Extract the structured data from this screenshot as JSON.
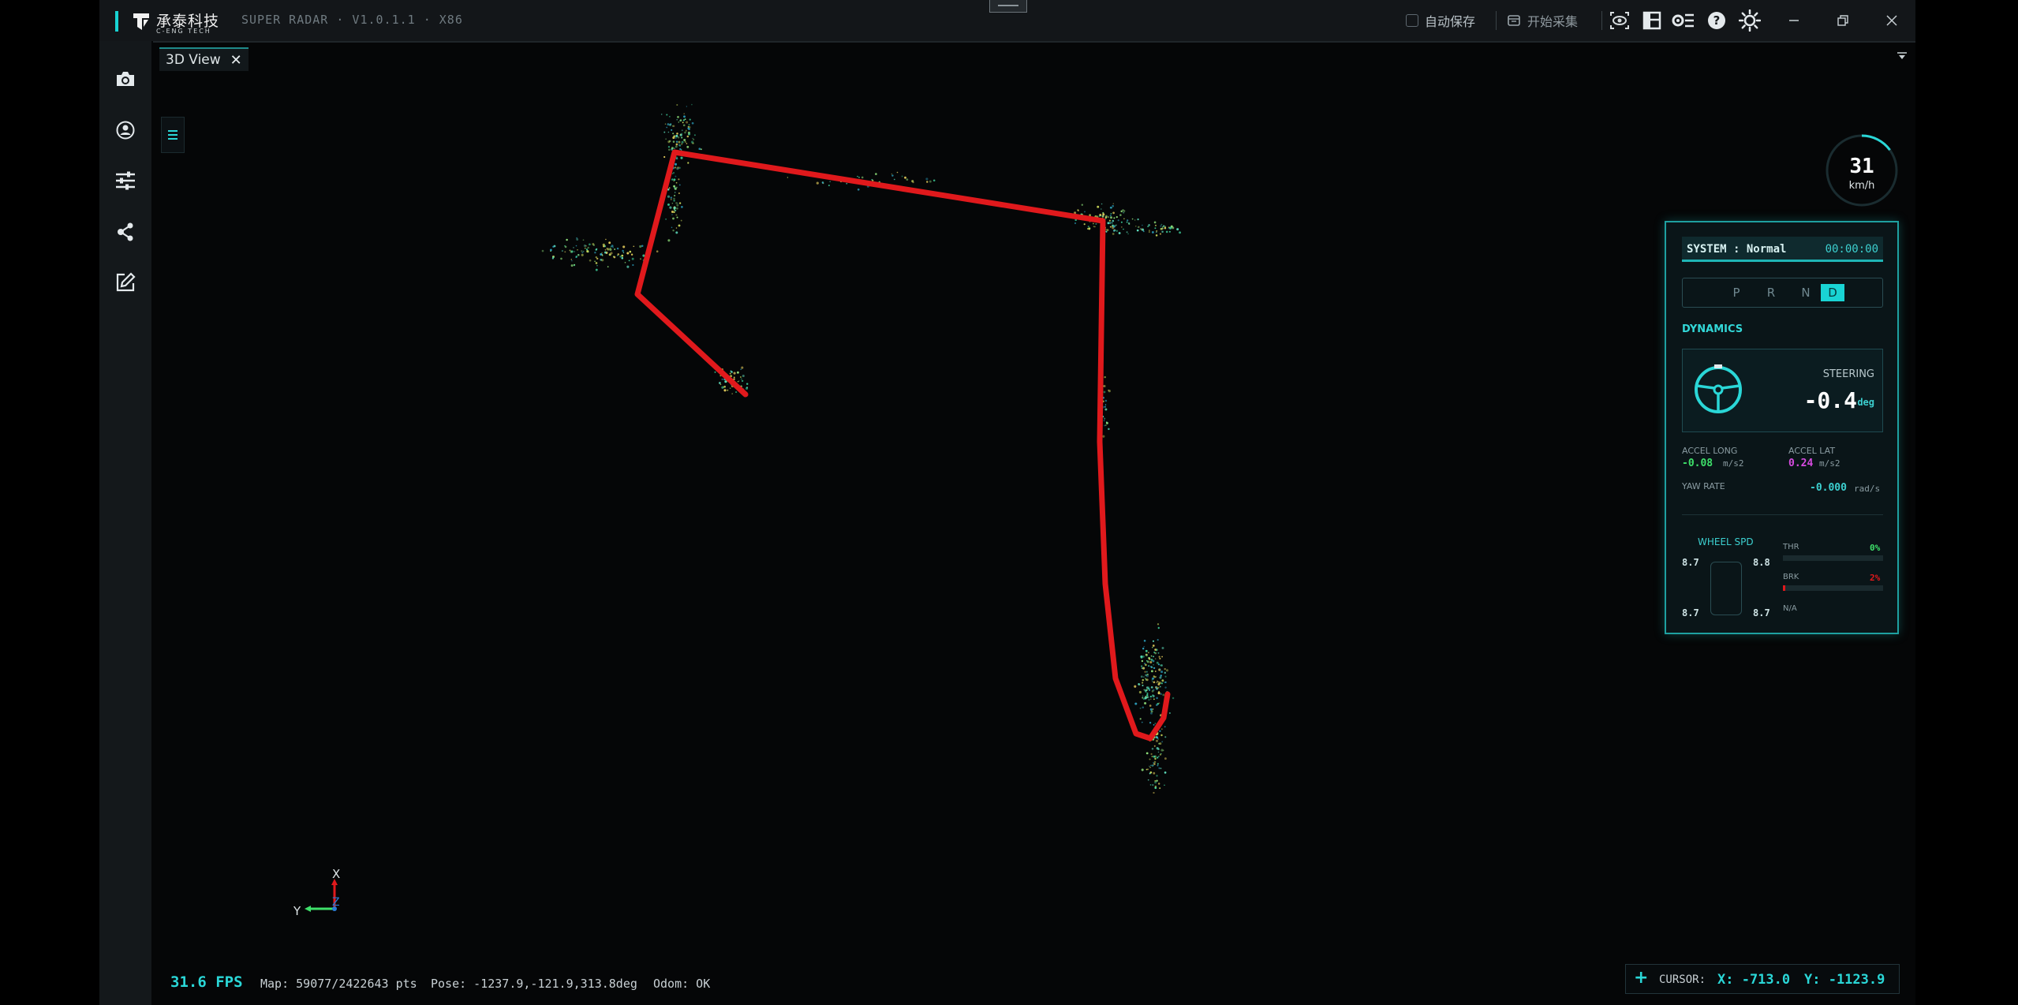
{
  "titlebar": {
    "logo_cn": "承泰科技",
    "logo_en": "C-ENG TECH",
    "app_title": "SUPER RADAR · V1.0.1.1 · X86",
    "autosave_label": "自动保存",
    "start_collect_label": "开始采集"
  },
  "tab": {
    "label": "3D View",
    "close": "✕"
  },
  "hud": {
    "speed": "31",
    "speed_unit": "km/h",
    "speed_ring_progress": 0.15
  },
  "panel": {
    "system_status": "SYSTEM : Normal",
    "system_time": "00:00:00",
    "gears": [
      "P",
      "R",
      "N",
      "D"
    ],
    "active_gear": "D",
    "dynamics_title": "DYNAMICS",
    "steering_title": "STEERING",
    "steering_value": "-0.4",
    "steering_unit": "deg",
    "accel_long_label": "ACCEL LONG",
    "accel_long_value": "-0.08",
    "accel_long_unit": "m/s2",
    "accel_lat_label": "ACCEL LAT",
    "accel_lat_value": "0.24",
    "accel_lat_unit": "m/s2",
    "yaw_rate_label": "YAW RATE",
    "yaw_rate_value": "-0.000",
    "yaw_rate_unit": "rad/s",
    "wheel_spd_title": "WHEEL SPD",
    "wheel_fl": "8.7",
    "wheel_fr": "8.8",
    "wheel_rl": "8.7",
    "wheel_rr": "8.7",
    "thr_label": "THR",
    "thr_pct": "0%",
    "thr_value": 0,
    "brk_label": "BRK",
    "brk_pct": "2%",
    "brk_value": 2,
    "na_label": "N/A"
  },
  "axes": {
    "x": "X",
    "y": "Y",
    "z": "Z"
  },
  "status": {
    "fps": "31.6 FPS",
    "map": "Map: 59077/2422643 pts",
    "pose": "Pose: -1237.9,-121.9,313.8deg",
    "odom": "Odom: OK"
  },
  "cursor": {
    "label": "CURSOR:",
    "x": "X: -713.0",
    "y": "Y: -1123.9"
  },
  "colors": {
    "accent": "#18d3d3",
    "trajectory": "#e0191c",
    "accel_long": "#3ee06a",
    "accel_lat": "#d64be0",
    "brake": "#e0191c",
    "throttle": "#3ee06a"
  }
}
